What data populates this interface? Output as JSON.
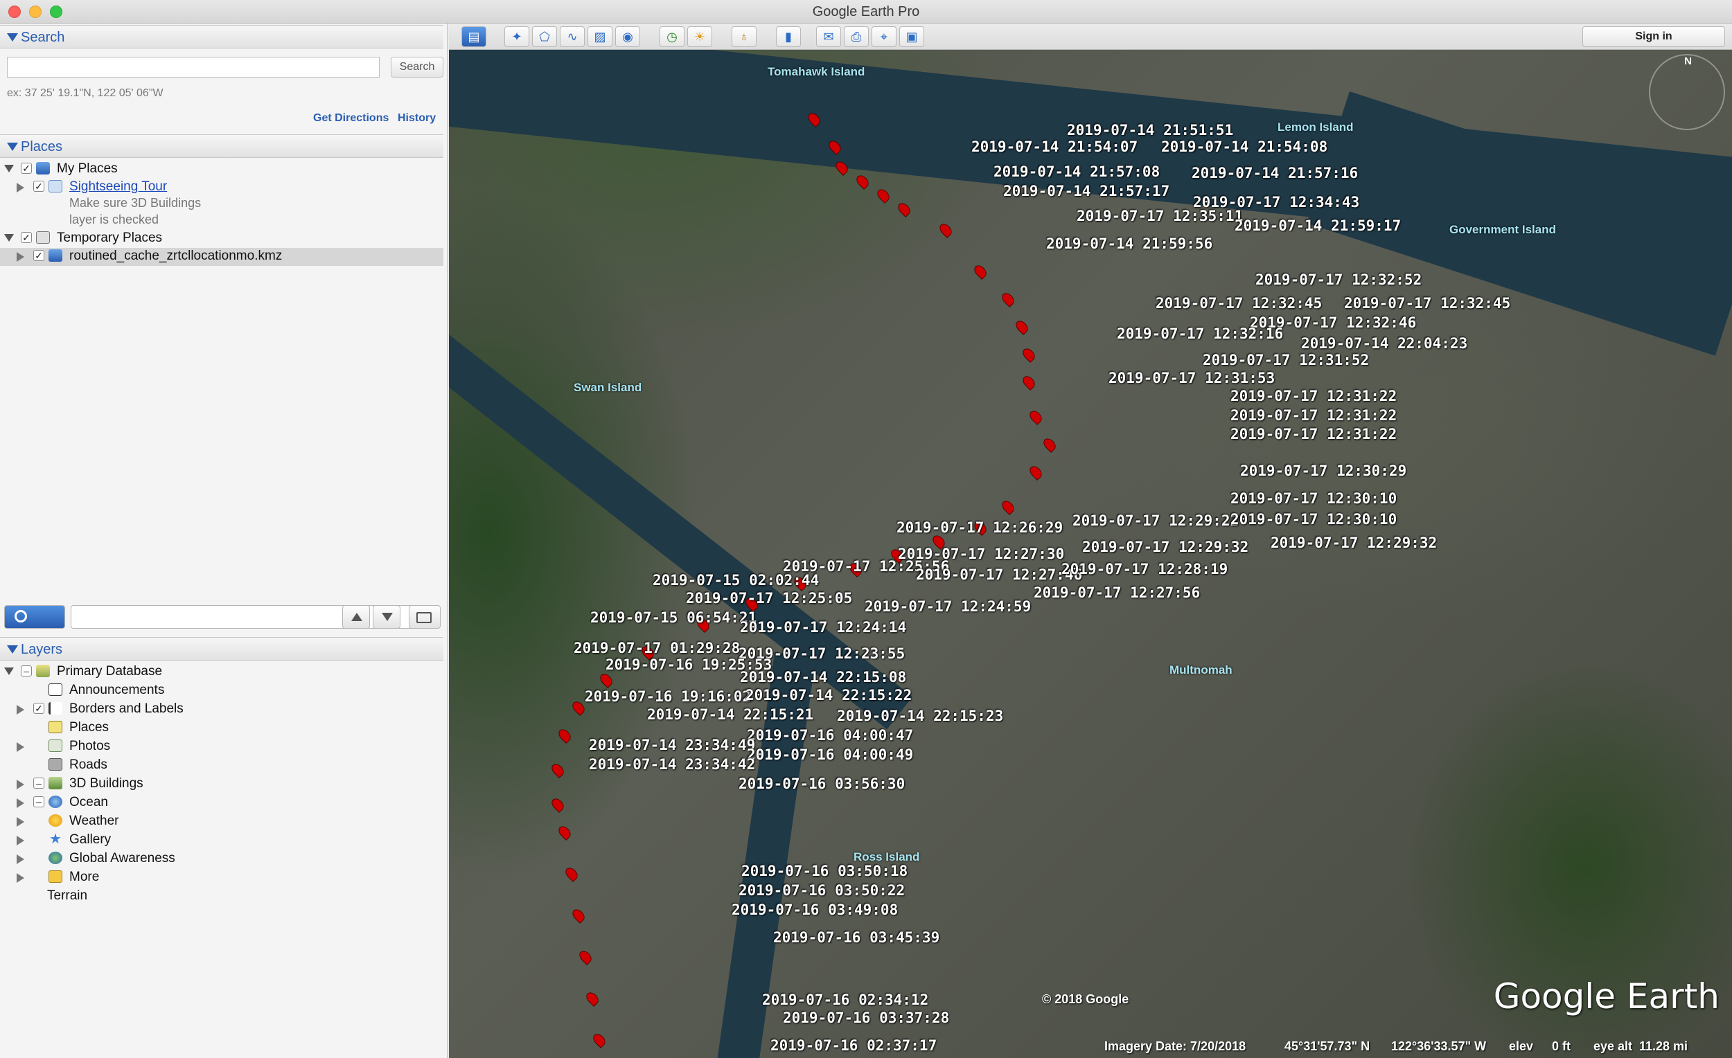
{
  "window": {
    "title": "Google Earth Pro"
  },
  "search": {
    "header": "Search",
    "placeholder": "",
    "button": "Search",
    "hint": "ex: 37 25' 19.1\"N, 122 05' 06\"W",
    "get_directions": "Get Directions",
    "history": "History"
  },
  "places": {
    "header": "Places",
    "items": [
      {
        "label": "My Places"
      },
      {
        "label": "Sightseeing Tour"
      },
      {
        "label": "Make sure 3D Buildings"
      },
      {
        "label": "layer is checked"
      },
      {
        "label": "Temporary Places"
      },
      {
        "label": "routined_cache_zrtcllocationmo.kmz"
      }
    ]
  },
  "layers": {
    "header": "Layers",
    "items": [
      {
        "label": "Primary Database"
      },
      {
        "label": "Announcements"
      },
      {
        "label": "Borders and Labels"
      },
      {
        "label": "Places"
      },
      {
        "label": "Photos"
      },
      {
        "label": "Roads"
      },
      {
        "label": "3D Buildings"
      },
      {
        "label": "Ocean"
      },
      {
        "label": "Weather"
      },
      {
        "label": "Gallery"
      },
      {
        "label": "Global Awareness"
      },
      {
        "label": "More"
      },
      {
        "label": "Terrain"
      }
    ]
  },
  "toolbar": {
    "sign_in": "Sign in"
  },
  "map": {
    "places": [
      "Tomahawk Island",
      "Lemon Island",
      "Government Island",
      "Swan Island",
      "Multnomah",
      "Ross Island"
    ],
    "compass_n": "N",
    "labels": [
      "2019-07-14 21:51:51",
      "2019-07-14 21:54:07",
      "2019-07-14 21:54:08",
      "2019-07-14 21:57:08",
      "2019-07-14 21:57:16",
      "2019-07-14 21:57:17",
      "2019-07-17 12:34:43",
      "2019-07-17 12:35:11",
      "2019-07-14 21:59:17",
      "2019-07-14 21:59:56",
      "2019-07-17 12:32:52",
      "2019-07-17 12:32:45",
      "2019-07-17 12:32:45",
      "2019-07-17 12:32:46",
      "2019-07-17 12:32:16",
      "2019-07-14 22:04:23",
      "2019-07-17 12:31:52",
      "2019-07-17 12:31:53",
      "2019-07-17 12:31:22",
      "2019-07-17 12:31:22",
      "2019-07-17 12:31:22",
      "2019-07-17 12:30:29",
      "2019-07-17 12:30:10",
      "2019-07-17 12:26:29",
      "2019-07-17 12:29:22",
      "2019-07-17 12:30:10",
      "2019-07-17 12:29:32",
      "2019-07-17 12:29:32",
      "2019-07-17 12:27:30",
      "2019-07-17 12:25:56",
      "2019-07-17 12:27:46",
      "2019-07-17 12:28:19",
      "2019-07-15 02:02:44",
      "2019-07-17 12:25:05",
      "2019-07-17 12:27:56",
      "2019-07-17 12:24:59",
      "2019-07-15 06:54:21",
      "2019-07-17 12:24:14",
      "2019-07-17 01:29:28",
      "2019-07-17 12:23:55",
      "2019-07-16 19:25:53",
      "2019-07-14 22:15:08",
      "2019-07-16 19:16:02",
      "2019-07-14 22:15:22",
      "2019-07-14 22:15:21",
      "2019-07-14 22:15:23",
      "2019-07-16 04:00:47",
      "2019-07-14 23:34:49",
      "2019-07-16 04:00:49",
      "2019-07-14 23:34:42",
      "2019-07-16 03:56:30",
      "2019-07-16 03:50:18",
      "2019-07-16 03:50:22",
      "2019-07-16 03:49:08",
      "2019-07-16 03:45:39",
      "2019-07-16 02:34:12",
      "2019-07-16 03:37:28",
      "2019-07-16 02:37:17"
    ],
    "copyright": "© 2018 Google",
    "logo": "Google Earth",
    "status": {
      "imagery_date": "Imagery Date: 7/20/2018",
      "lat": "45°31'57.73\" N",
      "lon": "122°36'33.57\" W",
      "elev_label": "elev",
      "elev_value": "0 ft",
      "eye_alt_label": "eye alt",
      "eye_alt_value": "11.28 mi"
    }
  }
}
